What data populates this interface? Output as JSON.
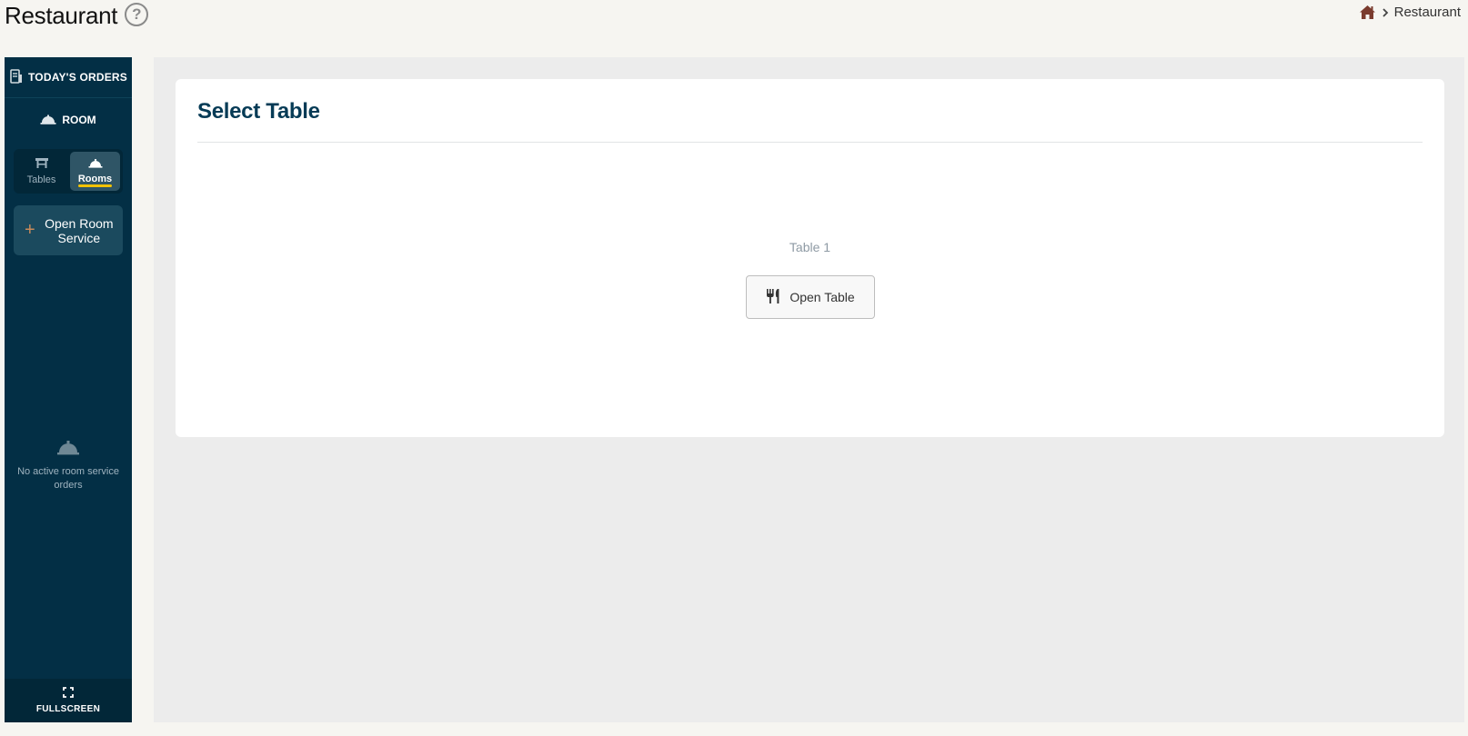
{
  "header": {
    "title": "Restaurant",
    "help_glyph": "?",
    "breadcrumb": {
      "home_icon": "home-icon",
      "separator_icon": "chevron-right-icon",
      "current": "Restaurant"
    }
  },
  "sidebar": {
    "todays_orders_label": "TODAY'S ORDERS",
    "room_label": "ROOM",
    "tabs": [
      {
        "label": "Tables",
        "icon": "table-icon",
        "active": false
      },
      {
        "label": "Rooms",
        "icon": "service-bell-icon",
        "active": true
      }
    ],
    "open_room_service": {
      "plus": "+",
      "label": "Open Room Service"
    },
    "empty_state": {
      "message": "No active room service orders"
    },
    "fullscreen_label": "FULLSCREEN"
  },
  "main": {
    "card_title": "Select Table",
    "tables": [
      {
        "name": "Table 1",
        "button_label": "Open Table"
      }
    ]
  },
  "colors": {
    "sidebar_bg": "#032f45",
    "accent_yellow": "#f2c200",
    "title_blue": "#063b56",
    "home_brown": "#7a3b2e"
  }
}
